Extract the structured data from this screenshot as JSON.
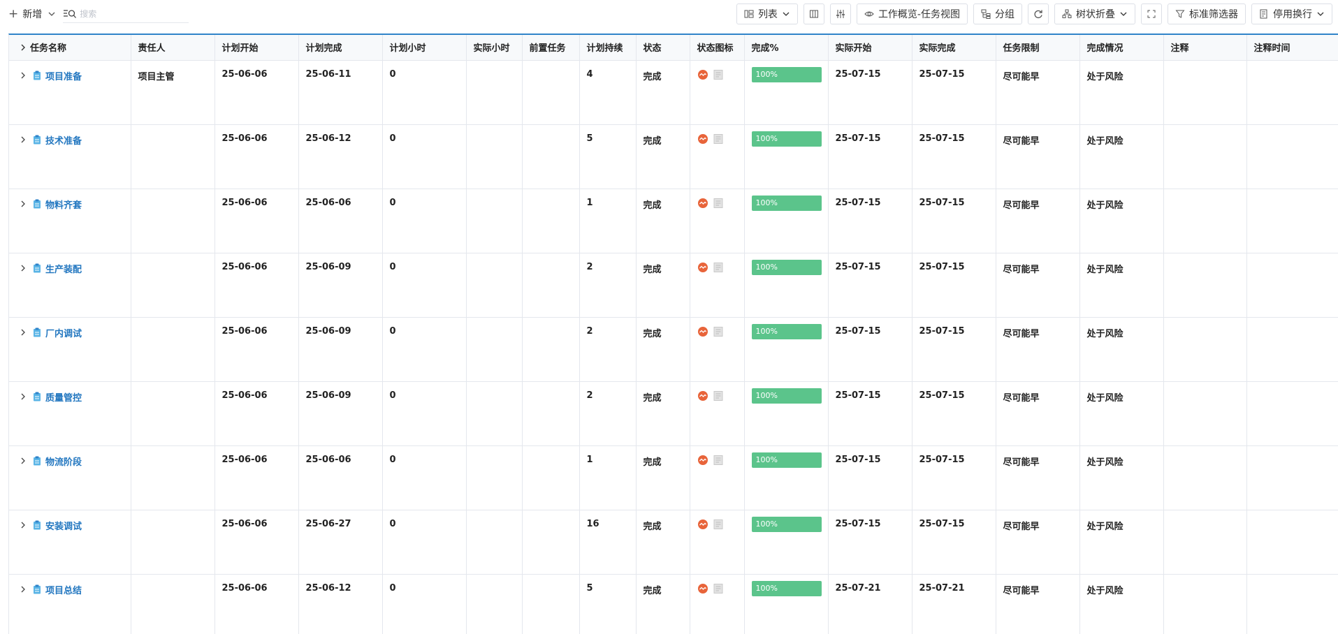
{
  "toolbar": {
    "add_label": "新增",
    "search_placeholder": "搜索",
    "list_label": "列表",
    "work_overview_label": "工作概览-任务视图",
    "group_label": "分组",
    "tree_collapse_label": "树状折叠",
    "standard_filter_label": "标准筛选器",
    "disable_wrap_label": "停用换行"
  },
  "colors": {
    "accent": "#2f83c9",
    "link": "#2377c0",
    "progress": "#5bc48b",
    "status_dot": "#e8643a"
  },
  "table": {
    "columns": [
      "任务名称",
      "责任人",
      "计划开始",
      "计划完成",
      "计划小时",
      "实际小时",
      "前置任务",
      "计划持续",
      "状态",
      "状态图标",
      "完成%",
      "实际开始",
      "实际完成",
      "任务限制",
      "完成情况",
      "注释",
      "注释时间"
    ],
    "rows": [
      {
        "name": "项目准备",
        "owner": "项目主管",
        "plan_start": "25-06-06",
        "plan_finish": "25-06-11",
        "plan_hours": "0",
        "actual_hours": "",
        "predecessor": "",
        "duration": "4",
        "status": "完成",
        "progress": 100,
        "progress_label": "100%",
        "actual_start": "25-07-15",
        "actual_finish": "25-07-15",
        "constraint": "尽可能早",
        "completion": "处于风险",
        "note": "",
        "note_time": ""
      },
      {
        "name": "技术准备",
        "owner": "",
        "plan_start": "25-06-06",
        "plan_finish": "25-06-12",
        "plan_hours": "0",
        "actual_hours": "",
        "predecessor": "",
        "duration": "5",
        "status": "完成",
        "progress": 100,
        "progress_label": "100%",
        "actual_start": "25-07-15",
        "actual_finish": "25-07-15",
        "constraint": "尽可能早",
        "completion": "处于风险",
        "note": "",
        "note_time": ""
      },
      {
        "name": "物料齐套",
        "owner": "",
        "plan_start": "25-06-06",
        "plan_finish": "25-06-06",
        "plan_hours": "0",
        "actual_hours": "",
        "predecessor": "",
        "duration": "1",
        "status": "完成",
        "progress": 100,
        "progress_label": "100%",
        "actual_start": "25-07-15",
        "actual_finish": "25-07-15",
        "constraint": "尽可能早",
        "completion": "处于风险",
        "note": "",
        "note_time": ""
      },
      {
        "name": "生产装配",
        "owner": "",
        "plan_start": "25-06-06",
        "plan_finish": "25-06-09",
        "plan_hours": "0",
        "actual_hours": "",
        "predecessor": "",
        "duration": "2",
        "status": "完成",
        "progress": 100,
        "progress_label": "100%",
        "actual_start": "25-07-15",
        "actual_finish": "25-07-15",
        "constraint": "尽可能早",
        "completion": "处于风险",
        "note": "",
        "note_time": ""
      },
      {
        "name": "厂内调试",
        "owner": "",
        "plan_start": "25-06-06",
        "plan_finish": "25-06-09",
        "plan_hours": "0",
        "actual_hours": "",
        "predecessor": "",
        "duration": "2",
        "status": "完成",
        "progress": 100,
        "progress_label": "100%",
        "actual_start": "25-07-15",
        "actual_finish": "25-07-15",
        "constraint": "尽可能早",
        "completion": "处于风险",
        "note": "",
        "note_time": ""
      },
      {
        "name": "质量管控",
        "owner": "",
        "plan_start": "25-06-06",
        "plan_finish": "25-06-09",
        "plan_hours": "0",
        "actual_hours": "",
        "predecessor": "",
        "duration": "2",
        "status": "完成",
        "progress": 100,
        "progress_label": "100%",
        "actual_start": "25-07-15",
        "actual_finish": "25-07-15",
        "constraint": "尽可能早",
        "completion": "处于风险",
        "note": "",
        "note_time": ""
      },
      {
        "name": "物流阶段",
        "owner": "",
        "plan_start": "25-06-06",
        "plan_finish": "25-06-06",
        "plan_hours": "0",
        "actual_hours": "",
        "predecessor": "",
        "duration": "1",
        "status": "完成",
        "progress": 100,
        "progress_label": "100%",
        "actual_start": "25-07-15",
        "actual_finish": "25-07-15",
        "constraint": "尽可能早",
        "completion": "处于风险",
        "note": "",
        "note_time": ""
      },
      {
        "name": "安装调试",
        "owner": "",
        "plan_start": "25-06-06",
        "plan_finish": "25-06-27",
        "plan_hours": "0",
        "actual_hours": "",
        "predecessor": "",
        "duration": "16",
        "status": "完成",
        "progress": 100,
        "progress_label": "100%",
        "actual_start": "25-07-15",
        "actual_finish": "25-07-15",
        "constraint": "尽可能早",
        "completion": "处于风险",
        "note": "",
        "note_time": ""
      },
      {
        "name": "项目总结",
        "owner": "",
        "plan_start": "25-06-06",
        "plan_finish": "25-06-12",
        "plan_hours": "0",
        "actual_hours": "",
        "predecessor": "",
        "duration": "5",
        "status": "完成",
        "progress": 100,
        "progress_label": "100%",
        "actual_start": "25-07-21",
        "actual_finish": "25-07-21",
        "constraint": "尽可能早",
        "completion": "处于风险",
        "note": "",
        "note_time": ""
      }
    ]
  }
}
